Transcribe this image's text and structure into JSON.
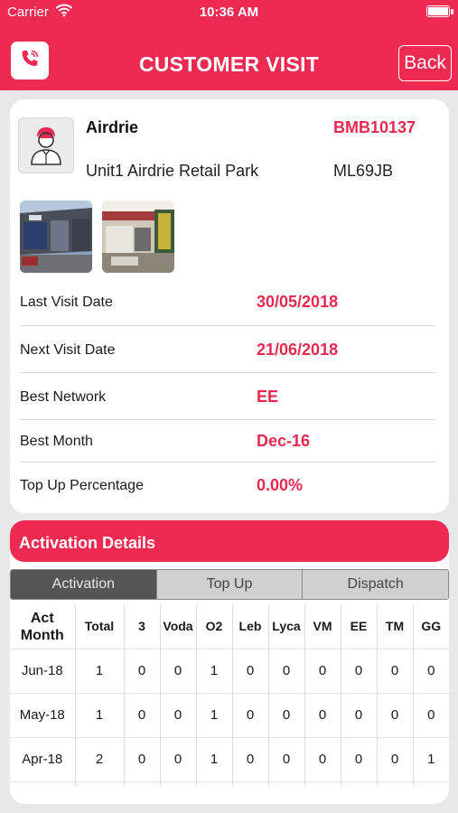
{
  "status_bar": {
    "carrier": "Carrier",
    "time": "10:36 AM"
  },
  "header": {
    "title": "CUSTOMER VISIT",
    "back_label": "Back"
  },
  "store": {
    "name": "Airdrie",
    "code": "BMB10137",
    "address": "Unit1  Airdrie Retail Park",
    "postcode": "ML69JB"
  },
  "visit_info": [
    {
      "label": "Last Visit Date",
      "value": "30/05/2018"
    },
    {
      "label": "Next Visit Date",
      "value": "21/06/2018"
    },
    {
      "label": "Best Network",
      "value": "EE"
    },
    {
      "label": "Best Month",
      "value": "Dec-16"
    },
    {
      "label": "Top Up Percentage",
      "value": "0.00%"
    }
  ],
  "activation": {
    "title": "Activation Details",
    "tabs": [
      "Activation",
      "Top Up",
      "Dispatch"
    ],
    "active_tab": "Activation",
    "columns": [
      "Act\nMonth",
      "Total",
      "3",
      "Voda",
      "O2",
      "Leb",
      "Lyca",
      "VM",
      "EE",
      "TM",
      "GG"
    ],
    "rows": [
      [
        "Jun-18",
        "1",
        "0",
        "0",
        "1",
        "0",
        "0",
        "0",
        "0",
        "0",
        "0"
      ],
      [
        "May-18",
        "1",
        "0",
        "0",
        "1",
        "0",
        "0",
        "0",
        "0",
        "0",
        "0"
      ],
      [
        "Apr-18",
        "2",
        "0",
        "0",
        "1",
        "0",
        "0",
        "0",
        "0",
        "0",
        "1"
      ]
    ]
  },
  "colors": {
    "brand": "#ee2952",
    "accent_text": "#e8294f",
    "tab_active": "#555555"
  },
  "icons": {
    "call": "phone-call-icon",
    "avatar": "shopkeeper-avatar-icon",
    "wifi": "wifi-icon",
    "battery": "battery-icon"
  }
}
